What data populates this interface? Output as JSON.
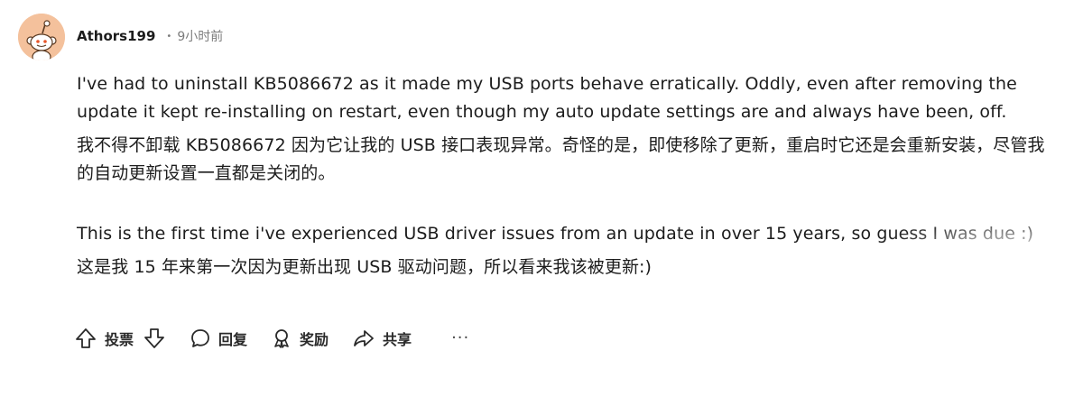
{
  "comment": {
    "author": "Athors199",
    "separator": "•",
    "time": "9小时前",
    "paragraphs": [
      "I've had to uninstall KB5086672 as it made my USB ports behave erratically. Oddly, even after removing the update it kept re-installing on restart, even though my auto update settings are and always have been, off.",
      "我不得不卸载 KB5086672 因为它让我的 USB 接口表现异常。奇怪的是，即使移除了更新，重启时它还是会重新安装，尽管我的自动更新设置一直都是关闭的。",
      "This is the first time i've experienced USB driver issues from an update in over 15 years, so guess I was due :)",
      "这是我 15 年来第一次因为更新出现 USB 驱动问题，所以看来我该被更新:)"
    ]
  },
  "actions": {
    "vote_label": "投票",
    "reply_label": "回复",
    "award_label": "奖励",
    "share_label": "共享",
    "more_label": "···"
  },
  "icons": {
    "upvote": "arrow-up-icon",
    "downvote": "arrow-down-icon",
    "reply": "speech-bubble-icon",
    "award": "award-icon",
    "share": "share-arrow-icon",
    "avatar": "reddit-snoo-avatar"
  },
  "colors": {
    "avatar_bg": "#f4c19c",
    "text": "#1c1c1c",
    "muted": "#7c7c7c"
  }
}
